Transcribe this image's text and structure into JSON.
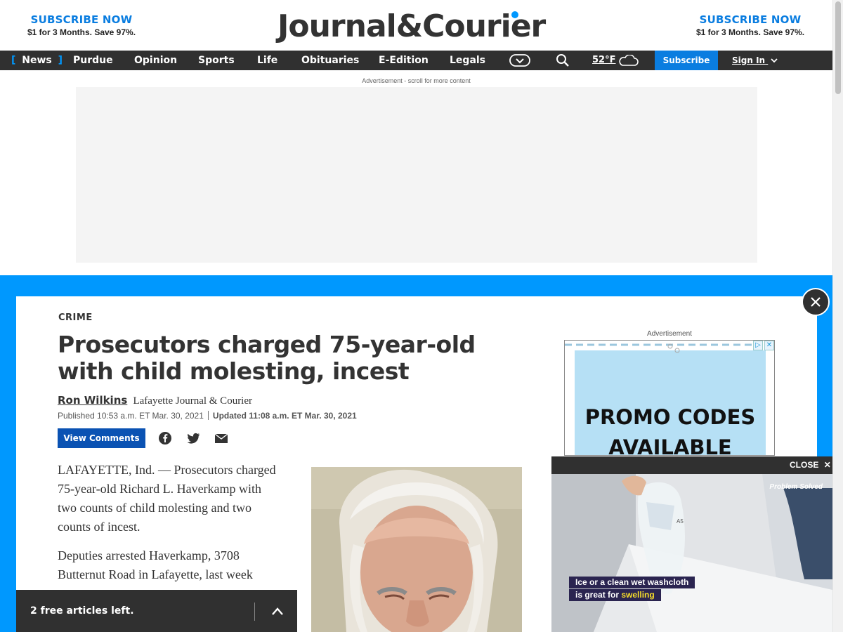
{
  "header": {
    "promo_left": {
      "title": "SUBSCRIBE NOW",
      "subtitle": "$1 for 3 Months. Save 97%."
    },
    "promo_right": {
      "title": "SUBSCRIBE NOW",
      "subtitle": "$1 for 3 Months. Save 97%."
    },
    "logo_text": "Journal&Courier"
  },
  "nav": {
    "items": [
      "News",
      "Purdue",
      "Opinion",
      "Sports",
      "Life",
      "Obituaries",
      "E-Edition",
      "Legals"
    ],
    "weather_temp": "52°F",
    "subscribe_label": "Subscribe",
    "signin_label": "Sign In",
    "icons": [
      "chevron-down-icon",
      "search-icon",
      "cloud-icon"
    ]
  },
  "ads": {
    "top_label": "Advertisement - scroll for more content",
    "right_label": "Advertisement",
    "promo_line1": "PROMO CODES",
    "promo_line2": "AVAILABLE"
  },
  "article": {
    "section": "CRIME",
    "headline": "Prosecutors charged 75-year-old with child molesting, incest",
    "author": "Ron Wilkins",
    "affiliation": "Lafayette Journal & Courier",
    "published": "Published 10:53 a.m. ET Mar. 30, 2021",
    "updated": "Updated 11:08 a.m. ET Mar. 30, 2021",
    "view_comments_label": "View Comments",
    "paragraphs": [
      "LAFAYETTE, Ind. — Prosecutors charged 75-year-old Richard L. Haverkamp with two counts of child molesting and two counts of incest.",
      "Deputies arrested Haverkamp, 3708 Butternut Road in Lafayette, last week"
    ]
  },
  "video": {
    "close_label": "CLOSE",
    "brand": "Problem Solved",
    "caption_line1": "Ice or a clean wet washcloth",
    "caption_line2_prefix": "is great for",
    "caption_line2_highlight": "swelling"
  },
  "paywall": {
    "free_articles": "2 free articles left."
  },
  "colors": {
    "accent": "#0098fe",
    "nav_bg": "#303030",
    "subscribe_blue": "#0a7de0",
    "button_blue": "#0a52b3"
  }
}
